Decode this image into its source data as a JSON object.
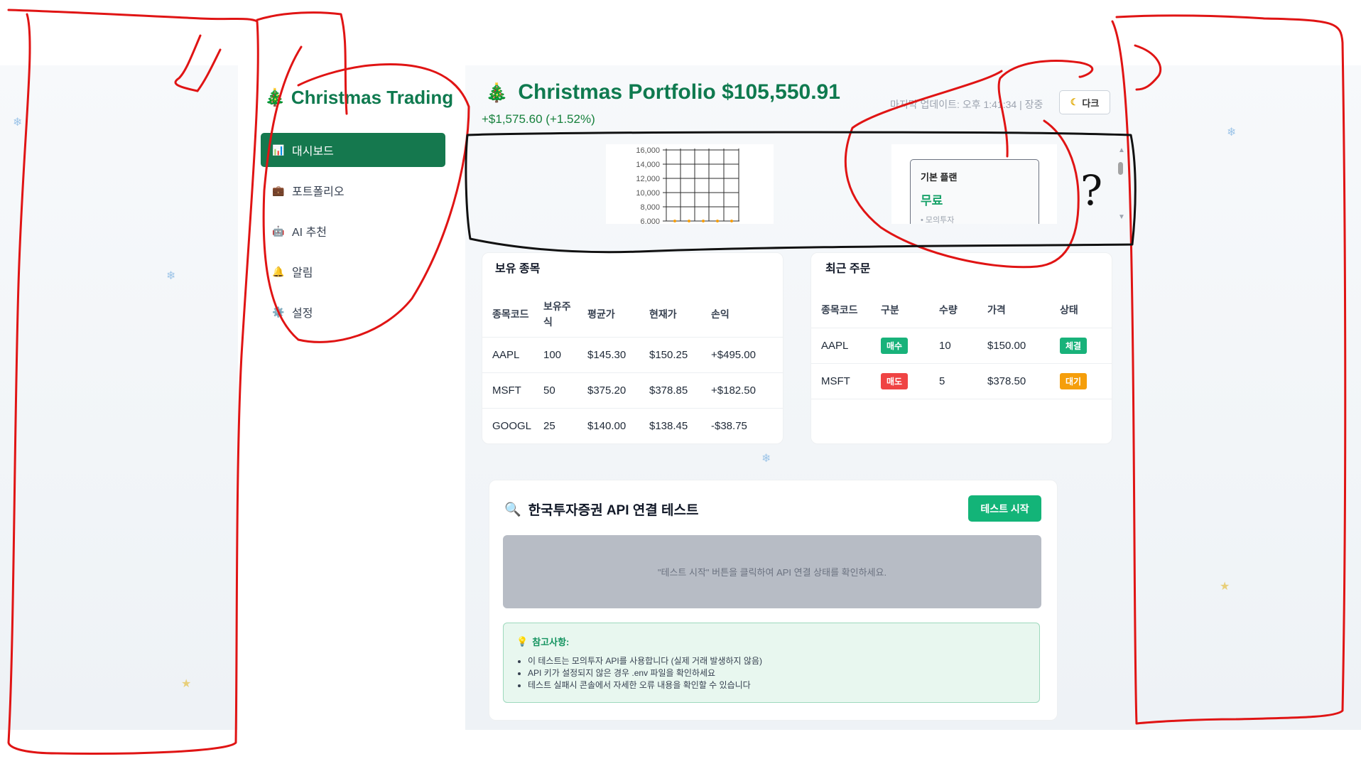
{
  "sidebar": {
    "brand": "Christmas Trading",
    "items": [
      {
        "icon": "📊",
        "label": "대시보드",
        "active": true
      },
      {
        "icon": "💼",
        "label": "포트폴리오",
        "active": false
      },
      {
        "icon": "🤖",
        "label": "AI 추천",
        "active": false
      },
      {
        "icon": "🔔",
        "label": "알림",
        "active": false
      },
      {
        "icon": "⚙️",
        "label": "설정",
        "active": false
      }
    ]
  },
  "header": {
    "title": "Christmas Portfolio $105,550.91",
    "change": "+$1,575.60 (+1.52%)",
    "updated": "마지막 업데이트: 오후 1:41:34 | 장중",
    "dark_button": "다크"
  },
  "chart": {
    "y_ticks": [
      "16,000",
      "14,000",
      "12,000",
      "10,000",
      "8,000",
      "6,000"
    ]
  },
  "plan": {
    "name": "기본 플랜",
    "price": "무료",
    "feature": "• 모의투자"
  },
  "holdings": {
    "title": "보유 종목",
    "columns": [
      "종목코드",
      "보유주식",
      "평균가",
      "현재가",
      "손익"
    ],
    "rows": [
      [
        "AAPL",
        "100",
        "$145.30",
        "$150.25",
        "+$495.00"
      ],
      [
        "MSFT",
        "50",
        "$375.20",
        "$378.85",
        "+$182.50"
      ],
      [
        "GOOGL",
        "25",
        "$140.00",
        "$138.45",
        "-$38.75"
      ]
    ]
  },
  "orders": {
    "title": "최근 주문",
    "columns": [
      "종목코드",
      "구분",
      "수량",
      "가격",
      "상태"
    ],
    "rows": [
      {
        "code": "AAPL",
        "side": "매수",
        "side_color": "#18b27a",
        "qty": "10",
        "price": "$150.00",
        "status": "체결",
        "status_color": "#18b27a"
      },
      {
        "code": "MSFT",
        "side": "매도",
        "side_color": "#ef4444",
        "qty": "5",
        "price": "$378.50",
        "status": "대기",
        "status_color": "#f59e0b"
      }
    ]
  },
  "api_test": {
    "title": "한국투자증권 API 연결 테스트",
    "button": "테스트 시작",
    "placeholder": "\"테스트 시작\" 버튼을 클릭하여 API 연결 상태를 확인하세요.",
    "note_title": "참고사항:",
    "notes": [
      "이 테스트는 모의투자 API를 사용합니다 (실제 거래 발생하지 않음)",
      "API 키가 설정되지 않은 경우 .env 파일을 확인하세요",
      "테스트 실패시 콘솔에서 자세한 오류 내용을 확인할 수 있습니다"
    ]
  },
  "annotation": {
    "question_mark": "?"
  }
}
